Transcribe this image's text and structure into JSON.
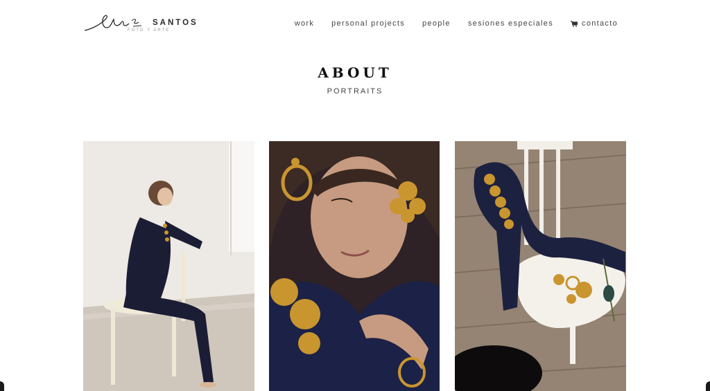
{
  "header": {
    "brand": "SANTOS",
    "tagline": "FOTO Y ARTE",
    "nav": [
      {
        "label": "work"
      },
      {
        "label": "personal projects"
      },
      {
        "label": "people"
      },
      {
        "label": "sesiones especiales"
      },
      {
        "label": "contacto",
        "icon": "cart-icon"
      }
    ]
  },
  "hero": {
    "title": "ABOUT",
    "subtitle": "PORTRAITS"
  },
  "gallery": [
    {
      "name": "photo-woman-seated-on-chair"
    },
    {
      "name": "photo-woman-portrait-earrings"
    },
    {
      "name": "photo-chair-velvet-jewelry"
    }
  ],
  "colors": {
    "text": "#444444",
    "title": "#111111",
    "gold": "#c9952f",
    "velvet": "#1c1f3a"
  }
}
